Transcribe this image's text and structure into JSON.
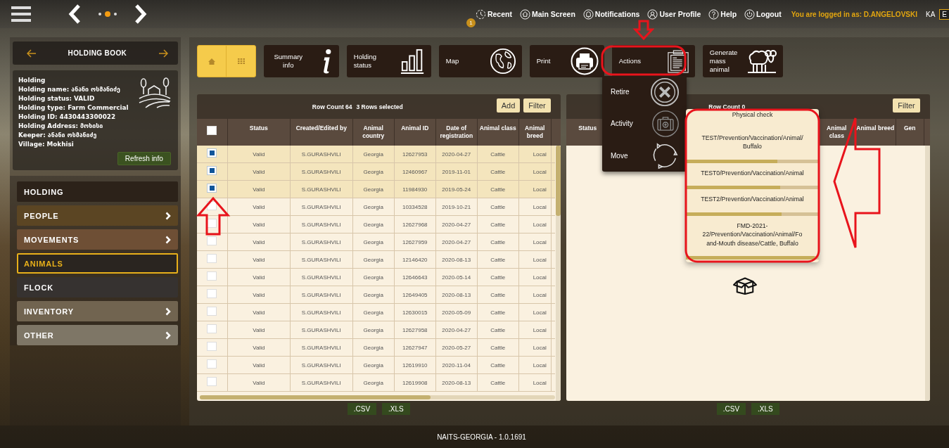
{
  "top_bar": {
    "nav_items": [
      {
        "label": "Recent",
        "badge": "1"
      },
      {
        "label": "Main Screen"
      },
      {
        "label": "Notifications"
      },
      {
        "label": "User Profile"
      },
      {
        "label": "Help"
      },
      {
        "label": "Logout"
      }
    ],
    "login_text": "You are logged in as: D.ANGELOVSKI",
    "language": "KA",
    "language_box": "E"
  },
  "sidebar": {
    "title": "HOLDING BOOK",
    "info_lines": [
      "Holding",
      "Holding name: ანანი ოსმანიძე",
      "Holding status: VALID",
      "Holding type: Farm Commercial",
      "Holding ID: 4430443300022",
      "Holding Address: მოხისი",
      "Keeper: ანანი ოსმანიძე",
      "Village: Mokhisi"
    ],
    "refresh_button": "Refresh info",
    "menu": [
      {
        "label": "HOLDING",
        "color": "#2c2219",
        "submenu": false,
        "selected": false
      },
      {
        "label": "PEOPLE",
        "color": "#5b4523",
        "submenu": true,
        "selected": false
      },
      {
        "label": "MOVEMENTS",
        "color": "#6e4f35",
        "submenu": true,
        "selected": false
      },
      {
        "label": "ANIMALS",
        "color": "#2a2520",
        "submenu": false,
        "selected": true
      },
      {
        "label": "FLOCK",
        "color": "#363230",
        "submenu": false,
        "selected": false
      },
      {
        "label": "INVENTORY",
        "color": "#716450",
        "submenu": true,
        "selected": false
      },
      {
        "label": "OTHER",
        "color": "#7e7666",
        "submenu": true,
        "selected": false
      }
    ]
  },
  "toolbar": [
    {
      "label": "Summary info"
    },
    {
      "label": "Holding status"
    },
    {
      "label": "Map"
    },
    {
      "label": "Print"
    },
    {
      "label": "Actions"
    },
    {
      "label": "Generate mass animal"
    }
  ],
  "actions_menu": [
    {
      "label": "Retire"
    },
    {
      "label": "Activity"
    },
    {
      "label": "Move"
    }
  ],
  "main_table": {
    "row_count": "Row Count 64",
    "selection": "3 Rows selected",
    "buttons": [
      "Add",
      "Filter"
    ],
    "all_checked": false,
    "columns": [
      "Status",
      "Created/Edited by",
      "Animal country",
      "Animal ID",
      "Date of registration",
      "Animal class",
      "Animal breed"
    ],
    "rows": [
      {
        "selected": true,
        "cells": [
          "Valid",
          "S.GURASHVILI",
          "Georgia",
          "12627953",
          "2020-04-27",
          "Cattle",
          "Local"
        ]
      },
      {
        "selected": true,
        "cells": [
          "Valid",
          "S.GURASHVILI",
          "Georgia",
          "12460967",
          "2019-11-01",
          "Cattle",
          "Local"
        ]
      },
      {
        "selected": true,
        "cells": [
          "Valid",
          "S.GURASHVILI",
          "Georgia",
          "11984930",
          "2019-05-24",
          "Cattle",
          "Local"
        ]
      },
      {
        "selected": false,
        "cells": [
          "Valid",
          "S.GURASHVILI",
          "Georgia",
          "10334528",
          "2019-10-21",
          "Cattle",
          "Local"
        ]
      },
      {
        "selected": false,
        "cells": [
          "Valid",
          "S.GURASHVILI",
          "Georgia",
          "12627968",
          "2020-04-27",
          "Cattle",
          "Local"
        ]
      },
      {
        "selected": false,
        "cells": [
          "Valid",
          "S.GURASHVILI",
          "Georgia",
          "12627959",
          "2020-04-27",
          "Cattle",
          "Local"
        ]
      },
      {
        "selected": false,
        "cells": [
          "Valid",
          "S.GURASHVILI",
          "Georgia",
          "12146420",
          "2020-08-13",
          "Cattle",
          "Local"
        ]
      },
      {
        "selected": false,
        "cells": [
          "Valid",
          "S.GURASHVILI",
          "Georgia",
          "12646643",
          "2020-05-14",
          "Cattle",
          "Local"
        ]
      },
      {
        "selected": false,
        "cells": [
          "Valid",
          "S.GURASHVILI",
          "Georgia",
          "12649405",
          "2020-08-13",
          "Cattle",
          "Local"
        ]
      },
      {
        "selected": false,
        "cells": [
          "Valid",
          "S.GURASHVILI",
          "Georgia",
          "12630015",
          "2020-05-09",
          "Cattle",
          "Local"
        ]
      },
      {
        "selected": false,
        "cells": [
          "Valid",
          "S.GURASHVILI",
          "Georgia",
          "12627958",
          "2020-04-27",
          "Cattle",
          "Local"
        ]
      },
      {
        "selected": false,
        "cells": [
          "Valid",
          "S.GURASHVILI",
          "Georgia",
          "12627947",
          "2020-05-27",
          "Cattle",
          "Local"
        ]
      },
      {
        "selected": false,
        "cells": [
          "Valid",
          "S.GURASHVILI",
          "Georgia",
          "12619910",
          "2020-11-04",
          "Cattle",
          "Local"
        ]
      },
      {
        "selected": false,
        "cells": [
          "Valid",
          "S.GURASHVILI",
          "Georgia",
          "12619908",
          "2020-08-13",
          "Cattle",
          "Local"
        ]
      }
    ],
    "export_buttons": [
      ".CSV",
      ".XLS"
    ]
  },
  "second_table": {
    "row_count": "Row Count 0",
    "buttons": [
      "Filter"
    ],
    "columns": [
      "Status",
      "Animal class",
      "Animal breed",
      "Gen"
    ],
    "export_buttons": [
      ".CSV",
      ".XLS"
    ]
  },
  "activity_popup": {
    "items": [
      {
        "lines": [
          "Physical check"
        ]
      },
      {
        "lines": [
          "TEST/Prevention/Vaccination/Animal/",
          "Buffalo"
        ],
        "level": 0.69
      },
      {
        "lines": [
          "TEST0/Prevention/Vaccination/Animal"
        ],
        "level": 0.71
      },
      {
        "lines": [
          "TEST2/Prevention/Vaccination/Animal"
        ],
        "level": 0.72
      },
      {
        "lines": [
          "FMD-2021-",
          "22/Prevention/Vaccination/Animal/Fo",
          "and-Mouth disease/Cattle, Buffalo"
        ],
        "level": 0.97
      }
    ]
  },
  "footer": "NAITS-GEORGIA - 1.0.1691"
}
